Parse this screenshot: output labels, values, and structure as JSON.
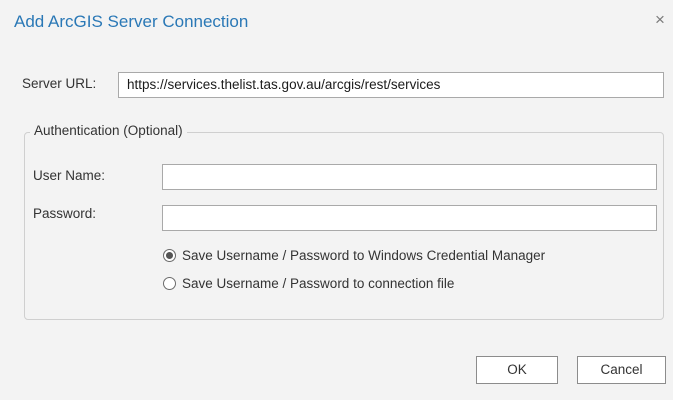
{
  "dialog": {
    "title": "Add ArcGIS Server Connection",
    "close_glyph": "×"
  },
  "server_url": {
    "label": "Server URL:",
    "value": "https://services.thelist.tas.gov.au/arcgis/rest/services"
  },
  "auth": {
    "group_label": "Authentication (Optional)",
    "username_label": "User Name:",
    "username_value": "",
    "password_label": "Password:",
    "password_value": "",
    "options": [
      {
        "label": "Save Username / Password to Windows Credential Manager",
        "checked": true
      },
      {
        "label": "Save Username / Password to connection file",
        "checked": false
      }
    ]
  },
  "buttons": {
    "ok": "OK",
    "cancel": "Cancel"
  },
  "colors": {
    "title": "#2a78b6",
    "background": "#f3f3f3"
  }
}
